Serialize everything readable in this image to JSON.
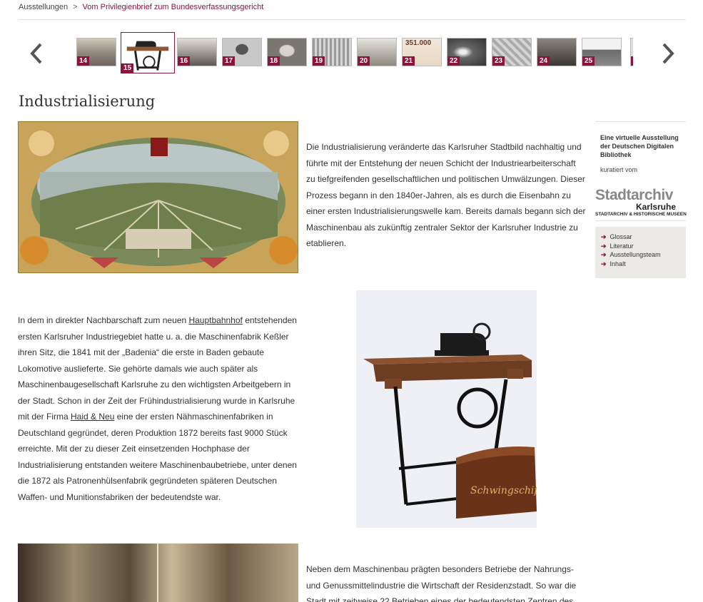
{
  "breadcrumb": {
    "root": "Ausstellungen",
    "separator": ">",
    "current": "Vom Privilegienbrief zum Bundesverfassungsgericht"
  },
  "carousel": {
    "prev_icon": "chevron-left-icon",
    "next_icon": "chevron-right-icon",
    "thumbnails": [
      {
        "number": "14",
        "active": false
      },
      {
        "number": "15",
        "active": true
      },
      {
        "number": "16",
        "active": false
      },
      {
        "number": "17",
        "active": false
      },
      {
        "number": "18",
        "active": false
      },
      {
        "number": "19",
        "active": false
      },
      {
        "number": "20",
        "active": false
      },
      {
        "number": "21",
        "active": false,
        "caption": "351.000"
      },
      {
        "number": "22",
        "active": false
      },
      {
        "number": "23",
        "active": false
      },
      {
        "number": "24",
        "active": false
      },
      {
        "number": "25",
        "active": false
      }
    ]
  },
  "page": {
    "title": "Industrialisierung"
  },
  "content": {
    "para1": "Die Industrialisierung veränderte das Karlsruher Stadtbild nachhaltig und führte mit der Entstehung der neuen Schicht der Industriearbeiterschaft zu tiefgreifenden gesellschaftlichen und politischen Umwälzungen. Dieser Prozess begann in den 1840er-Jahren, als es durch die Eisenbahn zu einer ersten Industrialisierungswelle kam. Bereits damals begann sich der Maschinenbau als zukünftig zentraler Sektor der Karlsruher Industrie zu etablieren.",
    "para2": {
      "part1": "In dem in direkter Nachbarschaft zum neuen ",
      "link1": "Hauptbahnhof",
      "part2": " entstehenden ersten Karlsruher Industriegebiet hatte u. a. die Maschinenfabrik Keßler ihren Sitz, die 1841 mit der „Badenia“ die erste in Baden gebaute Lokomotive auslieferte. Sie gehörte damals wie auch später als Maschinenbaugesellschaft Karlsruhe zu den wichtigsten Arbeitgebern in der Stadt. Schon in der Zeit der Frühindustrialisierung wurde in Karlsruhe mit der Firma ",
      "link2": "Haid & Neu",
      "part3": " eine der ersten Nähmaschinenfabriken in Deutschland gegründet, deren Produktion 1872 bereits fast 9000 Stück erreichte. Mit der zu dieser Zeit einsetzenden Hochphase der Industrialisierung entstanden weitere Maschinenbaubetriebe, unter denen die 1872 als Patronenhülsenfabrik gegründeten späteren Deutschen Waffen- und Munitionsfabriken der bedeutendste war."
    },
    "para3": "Neben dem Maschinenbau prägten besonders Betriebe der Nahrungs- und Genussmittelindustrie die Wirtschaft der Residenzstadt. So war die Stadt mit zeitweise 22 Betrieben eines der bedeutendsten Zentren des",
    "sewing_machine_label": "Schwingschiff"
  },
  "sidebar": {
    "heading": "Eine virtuelle Ausstellung der Deutschen Digitalen Bibliothek",
    "curated_by": "kuratiert vom",
    "logo_word1": "Stadtarchiv",
    "logo_word2": "Karlsruhe",
    "logo_sub": "STADTARCHIV & HISTORISCHE MUSEEN",
    "links": [
      "Glossar",
      "Literatur",
      "Ausstellungsteam",
      "Inhalt"
    ],
    "link_icon": "arrow-right-icon",
    "accent": "#8a1538"
  }
}
